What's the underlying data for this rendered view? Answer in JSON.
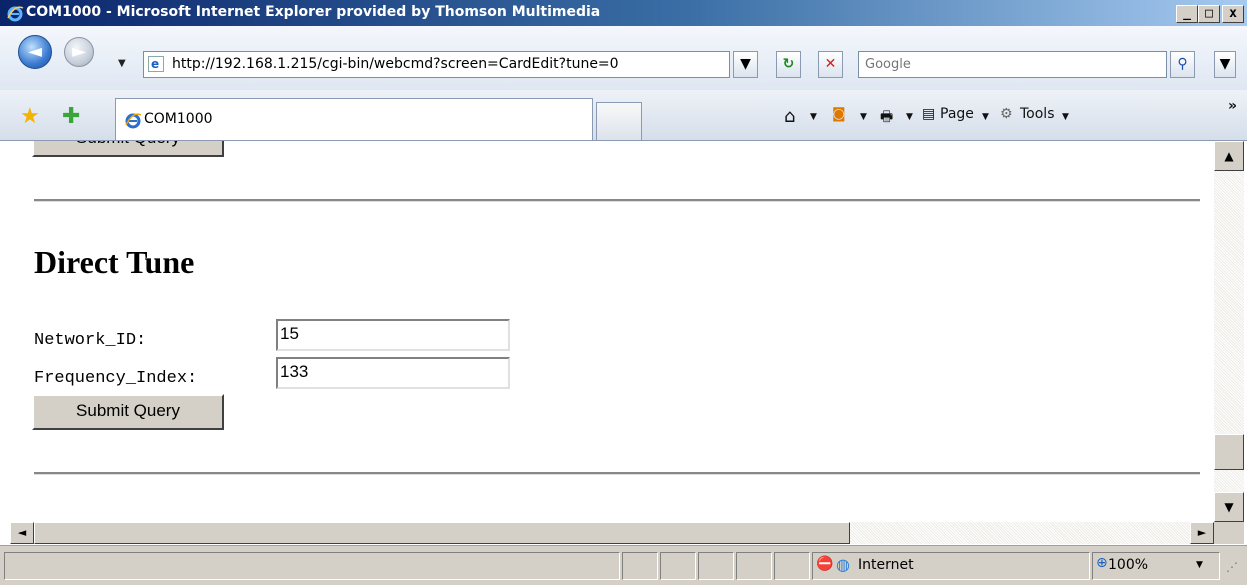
{
  "window": {
    "title": "COM1000 - Microsoft Internet Explorer provided by Thomson Multimedia",
    "min_label": "_",
    "max_label": "□",
    "close_label": "x"
  },
  "address": {
    "url": "http://192.168.1.215/cgi-bin/webcmd?screen=CardEdit?tune=0",
    "search_placeholder": "Google"
  },
  "tabs": {
    "active_label": "COM1000"
  },
  "commandbar": {
    "page_label": "Page",
    "tools_label": "Tools",
    "overflow": "»"
  },
  "content": {
    "top_button_label": "Submit Query",
    "section_title": "Direct Tune",
    "fields": [
      {
        "label": "Network_ID:",
        "value": "15"
      },
      {
        "label": "Frequency_Index:",
        "value": "133"
      }
    ],
    "submit_label": "Submit Query"
  },
  "statusbar": {
    "zone": "Internet",
    "zoom": "100%"
  },
  "colors": {
    "titlebar_start": "#0a246a",
    "titlebar_end": "#a6caf0",
    "chrome": "#d4d0c8"
  }
}
